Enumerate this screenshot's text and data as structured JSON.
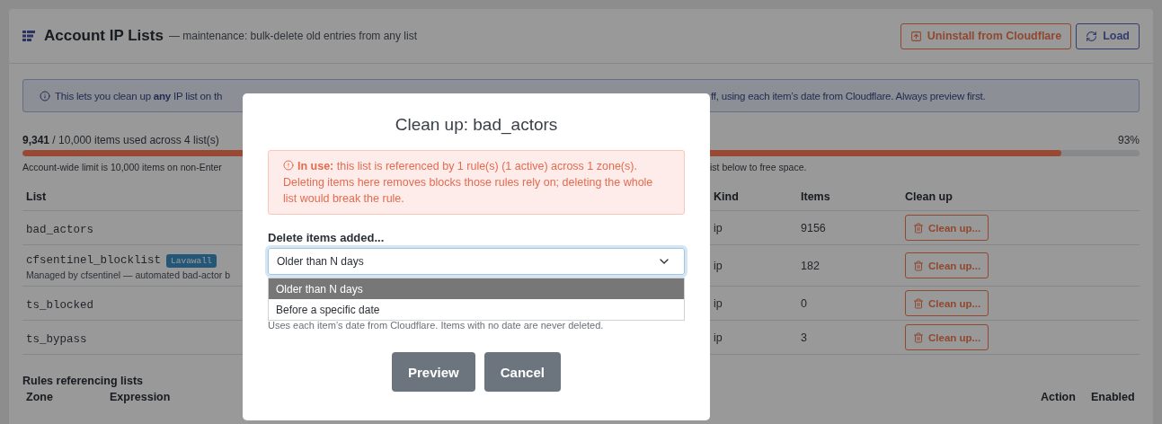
{
  "header": {
    "title": "Account IP Lists",
    "subtitle": "— maintenance: bulk-delete old entries from any list",
    "buttons": [
      {
        "label": "Uninstall from Cloudflare",
        "kind": "danger"
      },
      {
        "label": "Load",
        "kind": "primary"
      }
    ]
  },
  "info": {
    "left": "This lets you clean up **any** IP list on th",
    "right": "ff, using each item’s date from Cloudflare. Always preview first."
  },
  "usage": {
    "summary": "**9,341** / 10,000 items used across 4 list(s)",
    "percent": "93%",
    "level": 0.93,
    "note_left": "Account-wide limit is 10,000 items on non-Enter",
    "note_right": "ist below to free space."
  },
  "lists_table": {
    "columns": [
      "List",
      "Kind",
      "Items",
      "Clean up"
    ],
    "rows": [
      {
        "name": "bad_actors",
        "list_kind": "ip",
        "items": "9156",
        "action": "Clean up..."
      },
      {
        "name": "cfsentinel_blocklist",
        "badge": "Lavawall",
        "description": "Managed by cfsentinel — automated bad-actor b",
        "list_kind": "ip",
        "items": "182",
        "action": "Clean up..."
      },
      {
        "name": "ts_blocked",
        "list_kind": "ip",
        "items": "0",
        "action": "Clean up..."
      },
      {
        "name": "ts_bypass",
        "list_kind": "ip",
        "items": "3",
        "action": "Clean up..."
      }
    ]
  },
  "rules": {
    "title": "Rules referencing lists",
    "columns": [
      "Zone",
      "Expression",
      "Action",
      "Enabled"
    ]
  },
  "modal": {
    "title": "Clean up: bad_actors",
    "alert": "**In use:** this list is referenced by 1 rule(s) (1 active) across 1 zone(s). Deleting items here removes blocks those rules rely on; deleting the whole list would break the rule.",
    "field_label": "Delete items added...",
    "select_value": "Older than N days",
    "options": [
      {
        "label": "Older than N days",
        "selected": true
      },
      {
        "label": "Before a specific date",
        "selected": false
      }
    ],
    "hint": "Uses each item’s date from Cloudflare. Items with no date are never deleted.",
    "buttons": [
      "Preview",
      "Cancel"
    ]
  }
}
